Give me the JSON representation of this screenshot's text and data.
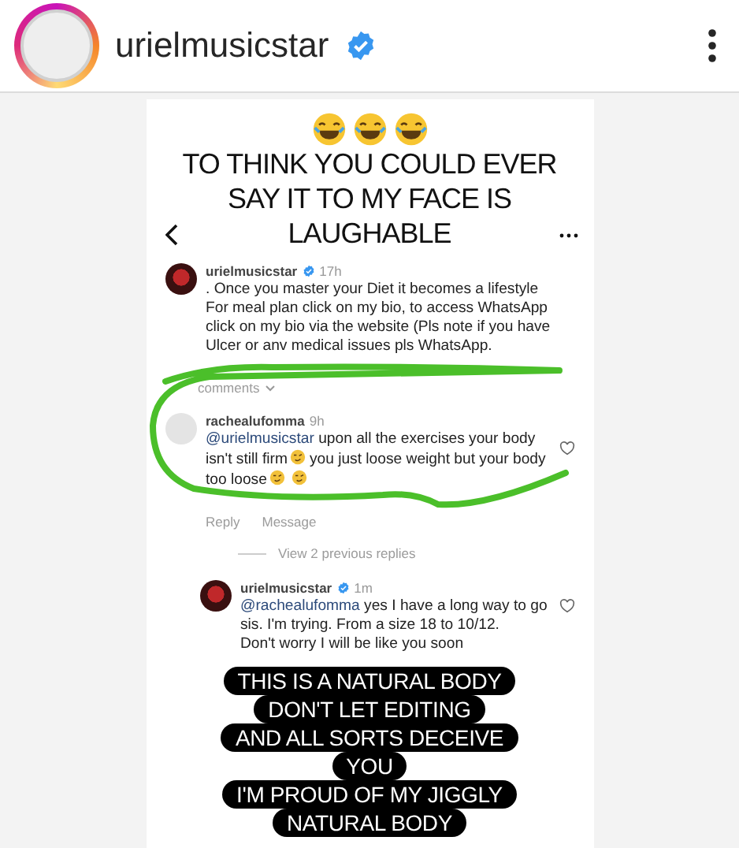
{
  "header": {
    "username": "urielmusicstar",
    "verified": true
  },
  "story": {
    "caption": "TO THINK YOU COULD EVER SAY IT TO MY FACE IS LAUGHABLE",
    "post": {
      "username": "urielmusicstar",
      "verified": true,
      "time": "17h",
      "text": ". Once you master your Diet it becomes a lifestyle\nFor meal plan click on my bio, to access WhatsApp click on my bio via the website (Pls note if you have Ulcer or anv medical issues pls WhatsApp."
    },
    "comments_toggle": "comments",
    "comment": {
      "username": "rachealufomma",
      "verified": false,
      "time": "9h",
      "mention": "@urielmusicstar",
      "text_parts": [
        "upon all the exercises your body isn't still firm",
        "you just loose weight but your body too loose"
      ],
      "actions": [
        "Reply",
        "Message"
      ]
    },
    "view_replies": "View 2 previous replies",
    "reply": {
      "username": "urielmusicstar",
      "verified": true,
      "time": "1m",
      "mention": "@rachealufomma",
      "text": "yes I have a long way to go sis. I'm trying. From a size 18 to 10/12.\nDon't worry I will be like you soon"
    },
    "sticker_lines": [
      "THIS IS A NATURAL BODY",
      "DON'T LET EDITING",
      "AND ALL SORTS DECEIVE",
      "YOU",
      "I'M PROUD OF MY JIGGLY",
      "NATURAL BODY"
    ]
  }
}
